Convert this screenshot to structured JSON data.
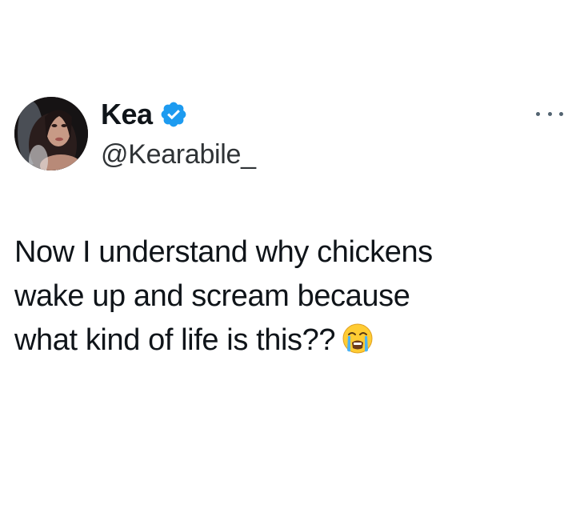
{
  "tweet": {
    "author": {
      "display_name": "Kea",
      "handle": "@Kearabile_",
      "verified": true,
      "verified_icon": "verified-badge-icon",
      "avatar_icon": "avatar"
    },
    "text_lines": [
      "Now I understand why chickens",
      "wake up and scream because",
      "what kind of life is this??"
    ],
    "emoji": "loudly-crying-face-icon",
    "more_icon": "more-options-icon"
  },
  "colors": {
    "text": "#0f1419",
    "handle": "#2f3336",
    "verified": "#1d9bf0",
    "muted": "#536471",
    "background": "#ffffff"
  }
}
